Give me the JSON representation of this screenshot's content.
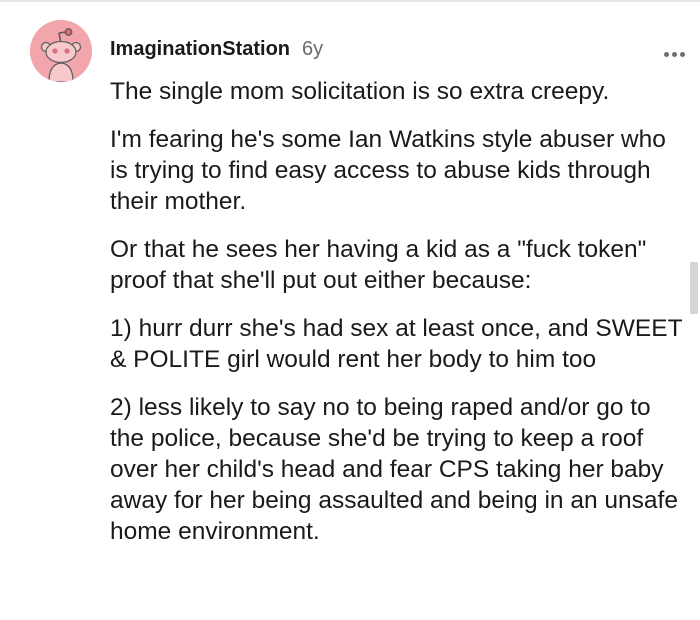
{
  "comment": {
    "username": "ImaginationStation",
    "age": "6y",
    "avatar_icon": "snoo-avatar-icon",
    "more_icon": "ellipsis-icon",
    "paragraphs": [
      "The single mom solicitation is so extra creepy.",
      "I'm fearing he's some Ian Watkins style abuser who is trying to find easy access to abuse kids through their mother.",
      "Or that he sees her having a kid as a \"fuck token\" proof that she'll put out either because:",
      "1) hurr durr she's had sex at least once, and SWEET & POLITE girl would rent her body to him too",
      "2) less likely to say no to being raped and/or go to the police, because she'd be trying to keep a roof over her child's head and fear CPS taking her baby away for her being assaulted and being in an unsafe home environment."
    ]
  },
  "colors": {
    "avatar_bg": "#f2a5ab",
    "text": "#1a1a1b",
    "muted": "#6a6a6a"
  }
}
